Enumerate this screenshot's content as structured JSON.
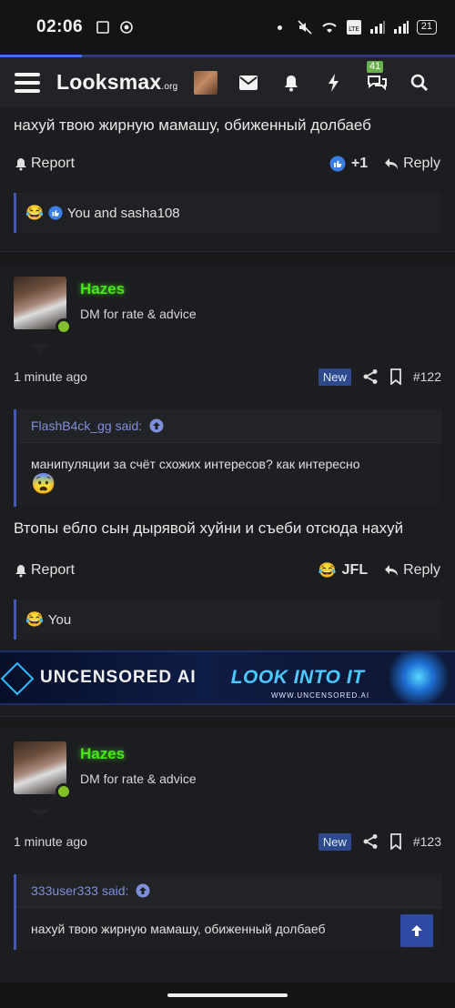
{
  "status_bar": {
    "time": "02:06",
    "battery": "21"
  },
  "header": {
    "logo_text": "Looksmax",
    "logo_suffix": ".org",
    "notification_count": "41"
  },
  "posts": [
    {
      "partial": true,
      "message": "нахуй твою жирную мамашу, обиженный долбаеб",
      "report_label": "Report",
      "reaction_count": "+1",
      "reply_label": "Reply",
      "reactions_text": "You and sasha108"
    },
    {
      "username": "Hazes",
      "user_title": "DM for rate & advice",
      "time": "1 minute ago",
      "badge": "New",
      "post_number": "#122",
      "quote": {
        "author": "FlashB4ck_gg said:",
        "text": "манипуляции за счёт схожих интересов? как интересно"
      },
      "message": "Втопы ебло сын дырявой хуйни и съеби отсюда нахуй",
      "report_label": "Report",
      "reaction_label": "JFL",
      "reply_label": "Reply",
      "reactions_text": "You"
    },
    {
      "username": "Hazes",
      "user_title": "DM for rate & advice",
      "time": "1 minute ago",
      "badge": "New",
      "post_number": "#123",
      "quote": {
        "author": "333user333 said:",
        "text": "нахуй твою жирную мамашу, обиженный долбаеб"
      }
    }
  ],
  "ad": {
    "left_text": "UNCENSORED AI",
    "right_text": "LOOK INTO IT",
    "url": "WWW.UNCENSORED.AI"
  },
  "colors": {
    "accent": "#4359b5",
    "username": "#49e61a",
    "background": "#1c1d20"
  }
}
